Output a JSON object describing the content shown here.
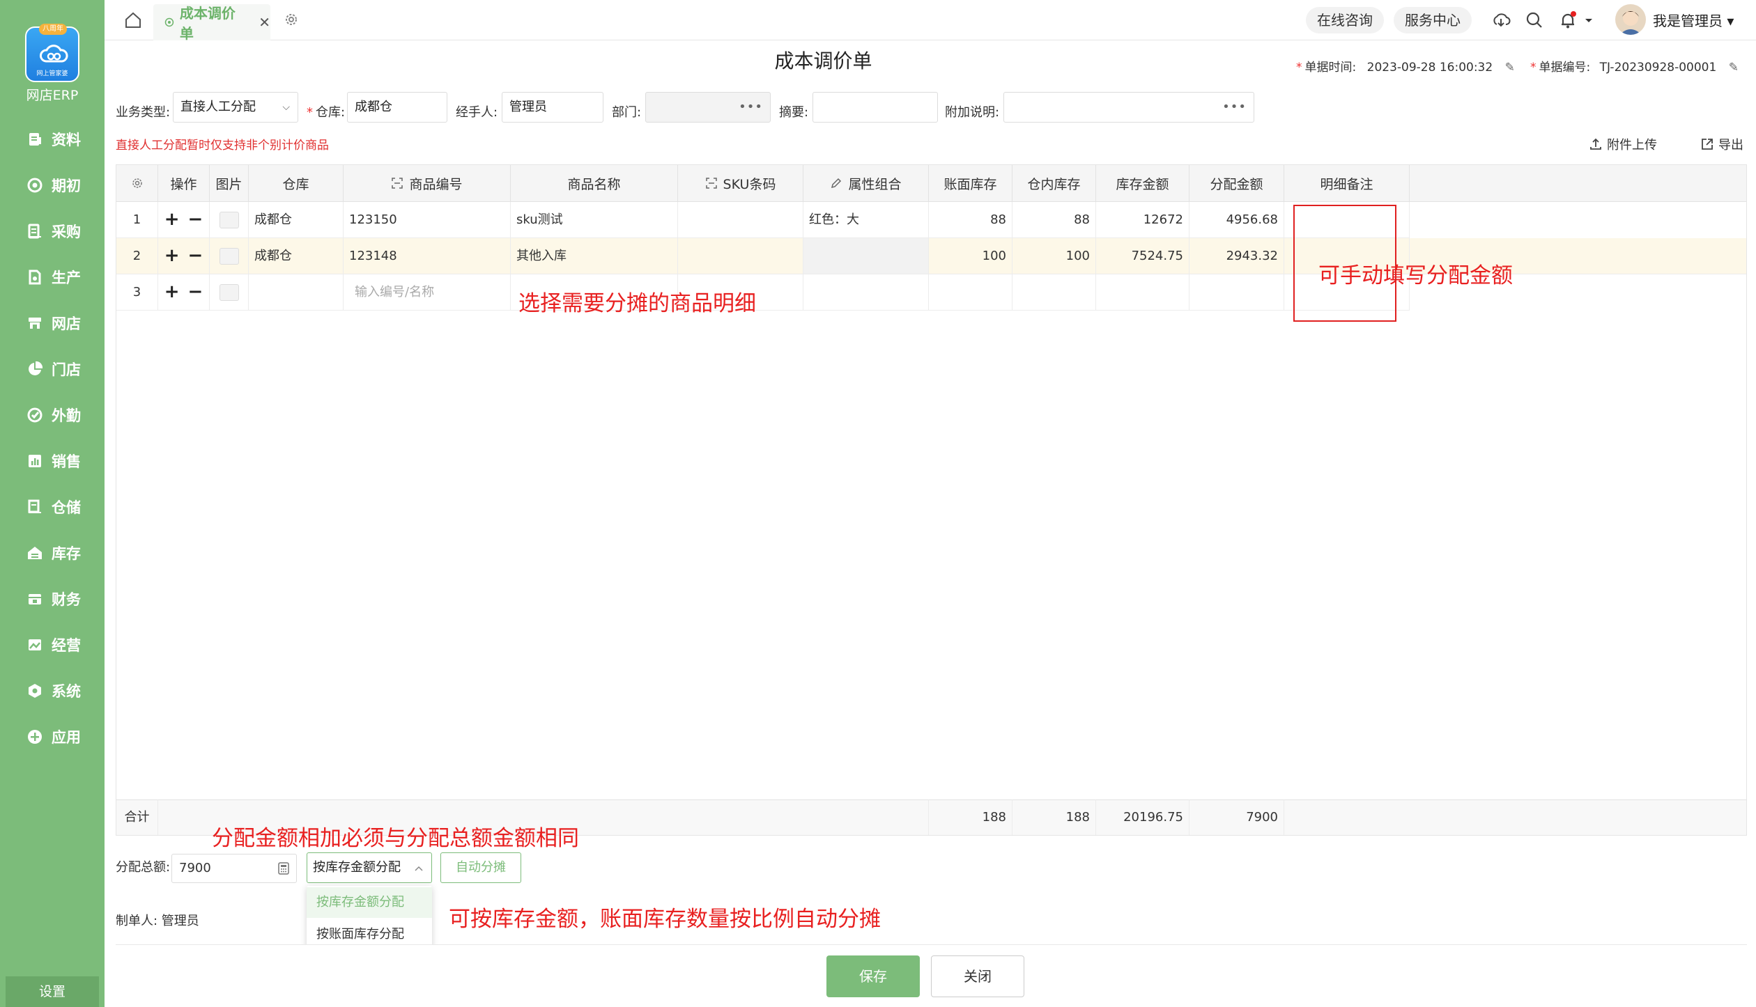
{
  "sidebar": {
    "logo_badge": "八周年",
    "logo_sub": "网上管家婆",
    "app_name": "网店ERP",
    "items": [
      {
        "label": "资料",
        "icon": "document-icon"
      },
      {
        "label": "期初",
        "icon": "target-icon"
      },
      {
        "label": "采购",
        "icon": "purchase-icon"
      },
      {
        "label": "生产",
        "icon": "production-icon"
      },
      {
        "label": "网店",
        "icon": "store-icon"
      },
      {
        "label": "门店",
        "icon": "pie-icon"
      },
      {
        "label": "外勤",
        "icon": "field-icon"
      },
      {
        "label": "销售",
        "icon": "bar-chart-icon"
      },
      {
        "label": "仓储",
        "icon": "warehouse-icon"
      },
      {
        "label": "库存",
        "icon": "inventory-icon"
      },
      {
        "label": "财务",
        "icon": "finance-icon"
      },
      {
        "label": "经营",
        "icon": "business-icon"
      },
      {
        "label": "系统",
        "icon": "system-icon"
      },
      {
        "label": "应用",
        "icon": "app-plus-icon"
      }
    ],
    "settings": "设置"
  },
  "topbar": {
    "tab_label": "成本调价单",
    "online_consult": "在线咨询",
    "service_center": "服务中心",
    "user_name": "我是管理员"
  },
  "header": {
    "title": "成本调价单",
    "doc_time_label": "单据时间:",
    "doc_time": "2023-09-28 16:00:32",
    "doc_no_label": "单据编号:",
    "doc_no": "TJ-20230928-00001"
  },
  "form": {
    "biz_type_label": "业务类型:",
    "biz_type": "直接人工分配",
    "warehouse_label": "仓库:",
    "warehouse": "成都仓",
    "handler_label": "经手人:",
    "handler": "管理员",
    "dept_label": "部门:",
    "dept": "",
    "summary_label": "摘要:",
    "summary": "",
    "note_label": "附加说明:",
    "note": ""
  },
  "warning": "直接人工分配暂时仅支持非个别计价商品",
  "actions": {
    "upload": "附件上传",
    "export": "导出"
  },
  "table": {
    "columns": [
      "操作",
      "图片",
      "仓库",
      "商品编号",
      "商品名称",
      "SKU条码",
      "属性组合",
      "账面库存",
      "仓内库存",
      "库存金额",
      "分配金额",
      "明细备注"
    ],
    "rows": [
      {
        "no": "1",
        "warehouse": "成都仓",
        "code": "123150",
        "name": "sku测试",
        "sku": "",
        "attr": "红色：大",
        "book_stock": "88",
        "stock_in": "88",
        "stock_amount": "12672",
        "alloc": "4956.68",
        "remark": ""
      },
      {
        "no": "2",
        "warehouse": "成都仓",
        "code": "123148",
        "name": "其他入库",
        "sku": "",
        "attr": "",
        "book_stock": "100",
        "stock_in": "100",
        "stock_amount": "7524.75",
        "alloc": "2943.32",
        "remark": ""
      },
      {
        "no": "3",
        "warehouse": "",
        "code_placeholder": "输入编号/名称",
        "name": "",
        "sku": "",
        "attr": "",
        "book_stock": "",
        "stock_in": "",
        "stock_amount": "",
        "alloc": "",
        "remark": ""
      }
    ],
    "footer": {
      "label": "合计",
      "book_stock": "188",
      "stock_in": "188",
      "stock_amount": "20196.75",
      "alloc": "7900"
    }
  },
  "annotations": {
    "manual": "可手动填写分配金额",
    "select": "选择需要分摊的商品明细",
    "total_rule": "分配金额相加必须与分配总额金额相同",
    "auto_rule": "可按库存金额，账面库存数量按比例自动分摊"
  },
  "allocation": {
    "total_label": "分配总额:",
    "total_value": "7900",
    "mode_selected": "按库存金额分配",
    "auto_button": "自动分摊",
    "options": [
      "按库存金额分配",
      "按账面库存分配"
    ]
  },
  "maker": "制单人: 管理员",
  "buttons": {
    "save": "保存",
    "close": "关闭"
  },
  "colors": {
    "accent": "#7cbc7a",
    "annotation": "#e82020",
    "warning": "#e03030",
    "highlight_row": "#fdf8e8"
  }
}
